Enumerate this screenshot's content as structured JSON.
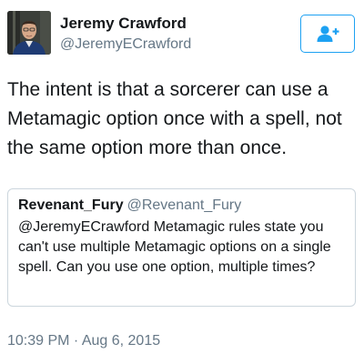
{
  "tweet": {
    "author": {
      "display_name": "Jeremy Crawford",
      "handle": "@JeremyECrawford"
    },
    "follow_button": {
      "icon": "add-user-icon",
      "color": "#1da1f2"
    },
    "text": "The intent is that a sorcerer can use a Metamagic option once with a spell, not the same option more than once.",
    "quoted": {
      "display_name": "Revenant_Fury",
      "handle": "@Revenant_Fury",
      "text": "@JeremyECrawford Metamagic rules state you can't use multiple Metamagic options on a single spell. Can you use one option, multiple times?"
    },
    "timestamp": "10:39 PM · Aug 6, 2015"
  },
  "colors": {
    "text_primary": "#14171a",
    "text_secondary": "#657786",
    "border": "#ccd6dd",
    "accent": "#1da1f2"
  }
}
